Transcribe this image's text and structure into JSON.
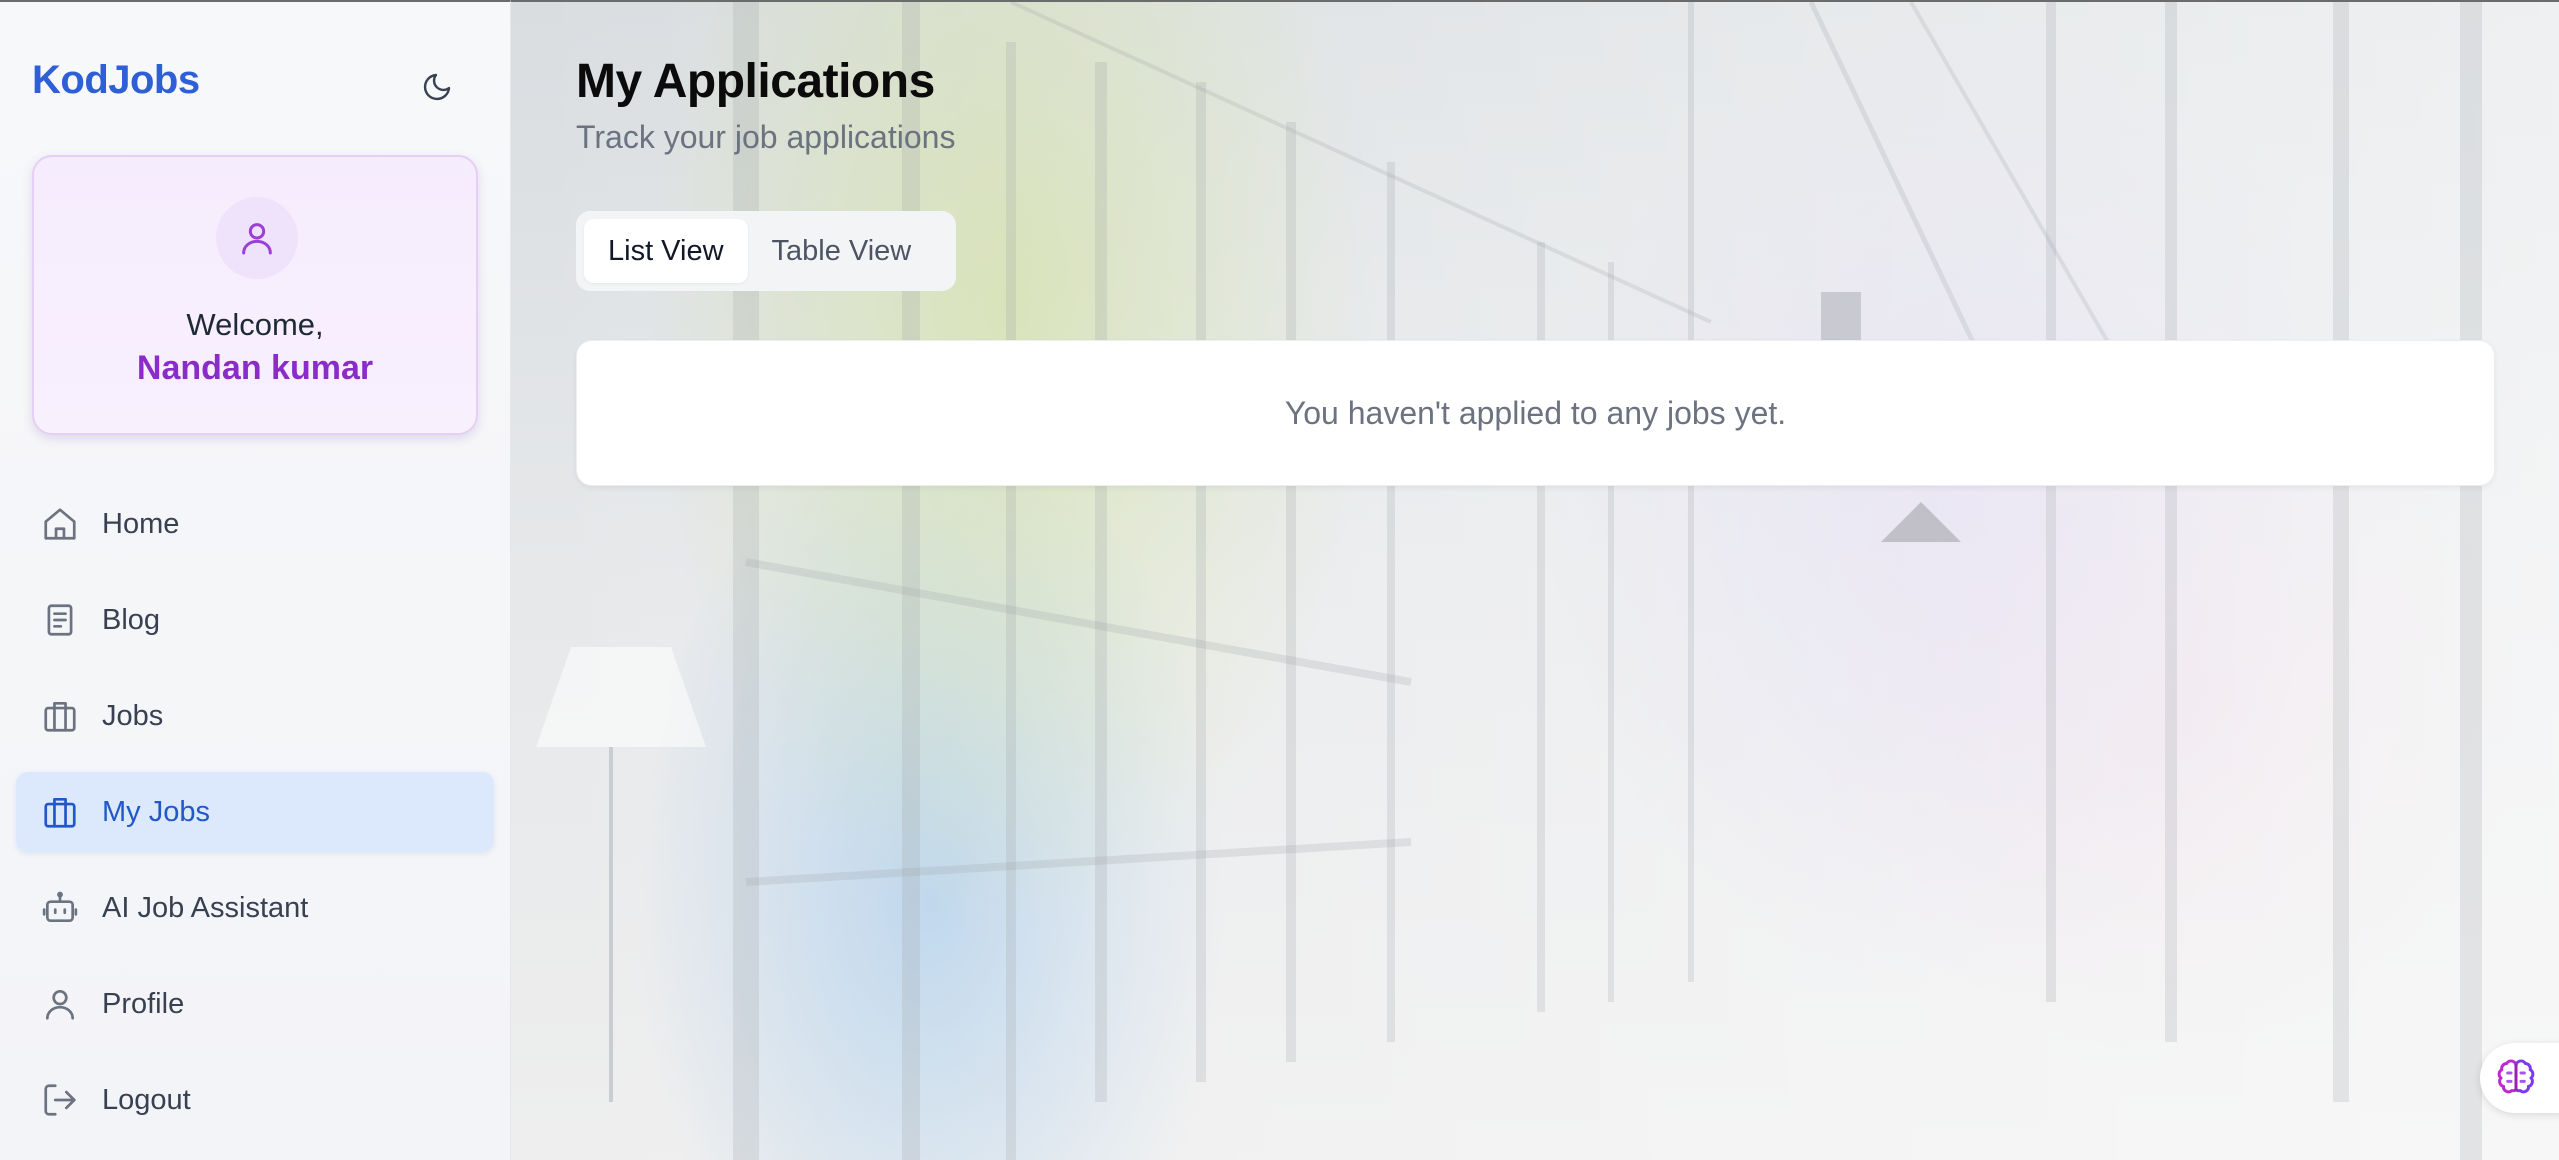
{
  "sidebar": {
    "brand": "KodJobs",
    "welcome": {
      "greeting": "Welcome,",
      "name": "Nandan kumar"
    },
    "items": [
      {
        "label": "Home",
        "icon": "home-icon",
        "active": false
      },
      {
        "label": "Blog",
        "icon": "book-icon",
        "active": false
      },
      {
        "label": "Jobs",
        "icon": "briefcase-icon",
        "active": false
      },
      {
        "label": "My Jobs",
        "icon": "briefcase-icon",
        "active": true
      },
      {
        "label": "AI Job Assistant",
        "icon": "robot-icon",
        "active": false
      },
      {
        "label": "Profile",
        "icon": "user-icon",
        "active": false
      },
      {
        "label": "Logout",
        "icon": "logout-icon",
        "active": false
      }
    ]
  },
  "main": {
    "title": "My Applications",
    "subtitle": "Track your job applications",
    "views": {
      "list": "List View",
      "table": "Table View",
      "selected": "List View"
    },
    "empty_message": "You haven't applied to any jobs yet."
  },
  "colors": {
    "brand": "#2f5fd6",
    "accent_purple": "#8a2dc8",
    "active_nav_bg": "#dce9fd",
    "active_nav_text": "#2257c8"
  }
}
